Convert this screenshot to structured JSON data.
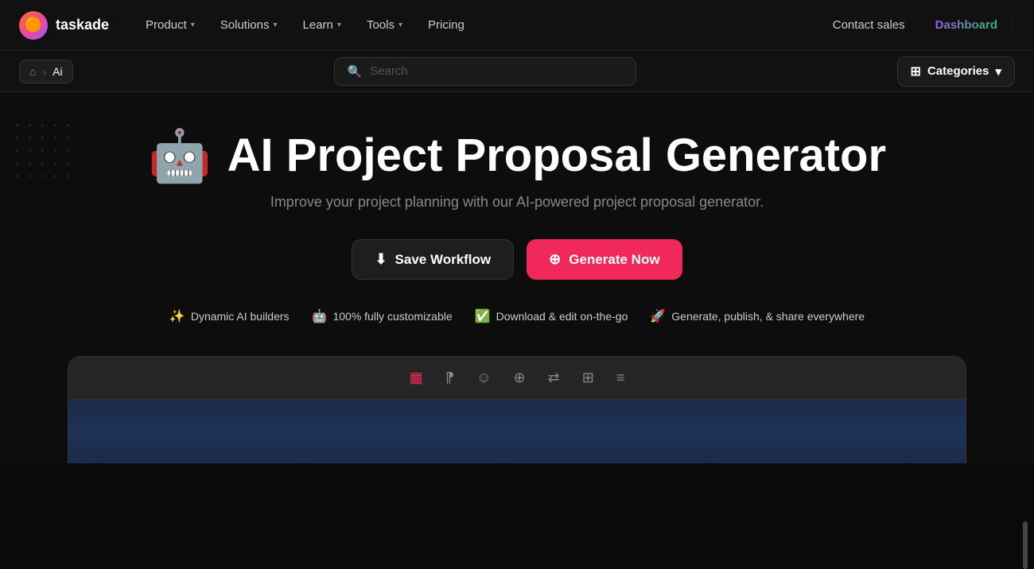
{
  "nav": {
    "logo_text": "taskade",
    "logo_emoji": "🟠",
    "items": [
      {
        "label": "Product",
        "has_chevron": true
      },
      {
        "label": "Solutions",
        "has_chevron": true
      },
      {
        "label": "Learn",
        "has_chevron": true
      },
      {
        "label": "Tools",
        "has_chevron": true
      },
      {
        "label": "Pricing",
        "has_chevron": false
      }
    ],
    "contact_sales": "Contact sales",
    "dashboard": "Dashboard"
  },
  "breadcrumb": {
    "home_icon": "⌂",
    "separator": "›",
    "current": "Ai"
  },
  "search": {
    "placeholder": "Search"
  },
  "categories": {
    "label": "Categories",
    "icon": "⊞"
  },
  "hero": {
    "robot_emoji": "🤖",
    "title": "AI Project Proposal Generator",
    "subtitle": "Improve your project planning with our AI-powered project proposal generator.",
    "save_btn": "Save Workflow",
    "generate_btn": "Generate Now"
  },
  "features": [
    {
      "icon": "✨",
      "text": "Dynamic AI builders"
    },
    {
      "icon": "🤖",
      "text": "100% fully customizable"
    },
    {
      "icon": "✅",
      "text": "Download & edit on-the-go"
    },
    {
      "icon": "🚀",
      "text": "Generate, publish, & share everywhere"
    }
  ],
  "toolbar": {
    "icons": [
      "▦",
      "⁋",
      "☺",
      "⊕",
      "⇄",
      "⊞",
      "≡"
    ]
  }
}
